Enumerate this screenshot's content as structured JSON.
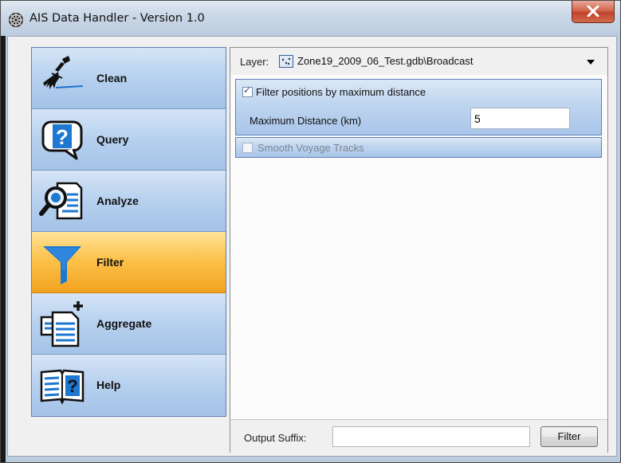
{
  "window": {
    "title": "AIS Data Handler - Version 1.0",
    "close_glyph": "X"
  },
  "nav": {
    "items": [
      {
        "label": "Clean",
        "icon": "broom-icon",
        "active": false
      },
      {
        "label": "Query",
        "icon": "question-bubble-icon",
        "active": false
      },
      {
        "label": "Analyze",
        "icon": "magnifier-document-icon",
        "active": false
      },
      {
        "label": "Filter",
        "icon": "funnel-icon",
        "active": true
      },
      {
        "label": "Aggregate",
        "icon": "aggregate-documents-icon",
        "active": false
      },
      {
        "label": "Help",
        "icon": "help-book-icon",
        "active": false
      }
    ]
  },
  "layer": {
    "label": "Layer:",
    "value": "Zone19_2009_06_Test.gdb\\Broadcast"
  },
  "filter_distance": {
    "checkbox_label": "Filter positions by maximum distance",
    "checked": true,
    "max_distance_label": "Maximum Distance (km)",
    "max_distance_value": "5"
  },
  "smooth_tracks": {
    "checkbox_label": "Smooth Voyage Tracks",
    "checked": false,
    "enabled": false
  },
  "footer": {
    "output_suffix_label": "Output Suffix:",
    "output_suffix_value": "",
    "filter_button": "Filter"
  },
  "colors": {
    "active_nav": "#f7b232",
    "nav_blue": "#b6d0ee",
    "title_bar": "#c9d6e5",
    "close_red": "#c8452c"
  }
}
